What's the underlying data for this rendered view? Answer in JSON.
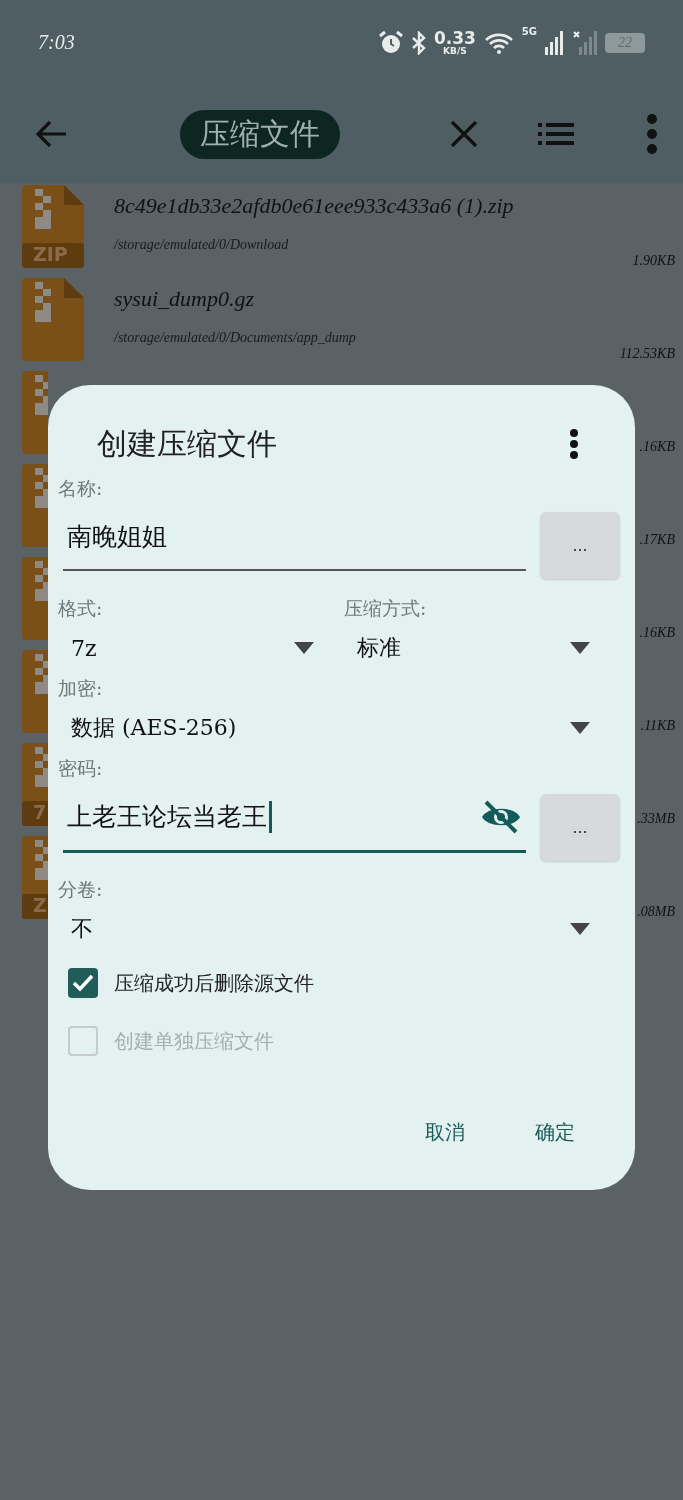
{
  "status_bar": {
    "time": "7:03",
    "net_speed": "0.33",
    "net_unit": "KB/S",
    "network": "5G",
    "battery": "22"
  },
  "toolbar": {
    "title": "压缩文件"
  },
  "files": [
    {
      "name": "8c49e1db33e2afdb0e61eee933c433a6 (1).zip",
      "path": "/storage/emulated/0/Download",
      "size": "1.90KB",
      "badge": "ZIP"
    },
    {
      "name": "sysui_dump0.gz",
      "path": "/storage/emulated/0/Documents/app_dump",
      "size": "112.53KB"
    },
    {
      "size": ".16KB"
    },
    {
      "size": ".17KB"
    },
    {
      "size": ".16KB"
    },
    {
      "size": ".11KB"
    },
    {
      "size": ".33MB",
      "badge": "7"
    },
    {
      "size": ".08MB",
      "badge": "Z"
    }
  ],
  "dialog": {
    "title": "创建压缩文件",
    "name_label": "名称:",
    "name_value": "南晚姐姐",
    "name_browse": "...",
    "format_label": "格式:",
    "format": "7z",
    "method_label": "压缩方式:",
    "method": "标准",
    "encryption_label": "加密:",
    "encryption": "数据 (AES-256)",
    "password_label": "密码:",
    "password": "上老王论坛当老王",
    "password_visible": true,
    "password_browse": "...",
    "split_label": "分卷:",
    "split": "不",
    "options": [
      {
        "label": "压缩成功后删除源文件",
        "checked": true,
        "disabled": false
      },
      {
        "label": "创建单独压缩文件",
        "checked": false,
        "disabled": true
      }
    ],
    "buttons": [
      {
        "label": "取消"
      },
      {
        "label": "确定"
      }
    ]
  }
}
